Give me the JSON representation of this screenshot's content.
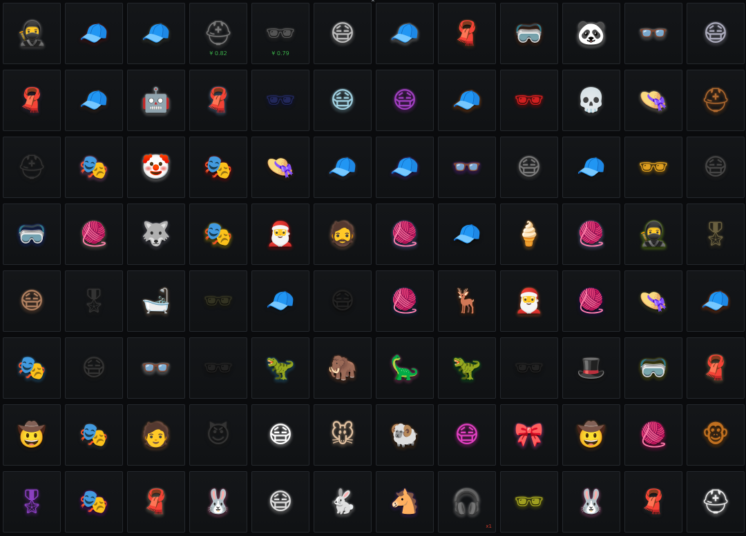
{
  "scroll_up_icon": "chevron-up-icon",
  "colors": {
    "price": "#3bb04a",
    "quantity": "#d03a2a",
    "tile_border": "#24282d"
  },
  "items": [
    {
      "icon": "balaclava-mask-icon",
      "glyph": "🥷",
      "color": "#9a9a9a"
    },
    {
      "icon": "cap-icon",
      "glyph": "🧢",
      "color": "#8a2a2a"
    },
    {
      "icon": "cap-icon",
      "glyph": "🧢",
      "color": "#6b6e5a"
    },
    {
      "icon": "pilot-helmet-icon",
      "glyph": "⛑",
      "color": "#7a7a7a",
      "price": "¥ 0.82"
    },
    {
      "icon": "sunglasses-icon",
      "glyph": "🕶",
      "color": "#555",
      "price": "¥ 0.79"
    },
    {
      "icon": "face-mask-icon",
      "glyph": "😷",
      "color": "#bbb"
    },
    {
      "icon": "cap-icon",
      "glyph": "🧢",
      "color": "#ddd"
    },
    {
      "icon": "scarf-icon",
      "glyph": "🧣",
      "color": "#8a5a30"
    },
    {
      "icon": "goggles-icon",
      "glyph": "🥽",
      "color": "#8a4a2a"
    },
    {
      "icon": "panda-headband-icon",
      "glyph": "🐼",
      "color": "#eee"
    },
    {
      "icon": "glasses-icon",
      "glyph": "👓",
      "color": "#ccc"
    },
    {
      "icon": "face-mask-icon",
      "glyph": "😷",
      "color": "#aab"
    },
    {
      "icon": "bandana-icon",
      "glyph": "🧣",
      "color": "#5a4a6a"
    },
    {
      "icon": "flat-cap-icon",
      "glyph": "🧢",
      "color": "#6a4a38"
    },
    {
      "icon": "robot-mask-icon",
      "glyph": "🤖",
      "color": "#ccc"
    },
    {
      "icon": "bandana-icon",
      "glyph": "🧣",
      "color": "#8ab0e0"
    },
    {
      "icon": "visor-icon",
      "glyph": "🕶",
      "color": "#22285a"
    },
    {
      "icon": "face-mask-icon",
      "glyph": "😷",
      "color": "#a0d0e0"
    },
    {
      "icon": "gas-mask-icon",
      "glyph": "😷",
      "color": "#a040c0"
    },
    {
      "icon": "cap-icon",
      "glyph": "🧢",
      "color": "#e07020"
    },
    {
      "icon": "sunglasses-icon",
      "glyph": "🕶",
      "color": "#d02020"
    },
    {
      "icon": "skull-mask-icon",
      "glyph": "💀",
      "color": "#888"
    },
    {
      "icon": "pith-helmet-icon",
      "glyph": "👒",
      "color": "#e0d0b0"
    },
    {
      "icon": "aviator-helmet-icon",
      "glyph": "⛑",
      "color": "#b06a30"
    },
    {
      "icon": "motorcycle-helmet-icon",
      "glyph": "⛑",
      "color": "#333"
    },
    {
      "icon": "cyber-mask-icon",
      "glyph": "🎭",
      "color": "#e080c0"
    },
    {
      "icon": "clown-mask-icon",
      "glyph": "🤡",
      "color": "#eee"
    },
    {
      "icon": "luchador-mask-icon",
      "glyph": "🎭",
      "color": "#c02020"
    },
    {
      "icon": "bucket-hat-icon",
      "glyph": "👒",
      "color": "#5a3a20"
    },
    {
      "icon": "beret-icon",
      "glyph": "🧢",
      "color": "#556"
    },
    {
      "icon": "cap-icon",
      "glyph": "🧢",
      "color": "#6a40c0"
    },
    {
      "icon": "round-glasses-icon",
      "glyph": "👓",
      "color": "#8a40d0"
    },
    {
      "icon": "face-mask-icon",
      "glyph": "😷",
      "color": "#777"
    },
    {
      "icon": "cap-icon",
      "glyph": "🧢",
      "color": "#333"
    },
    {
      "icon": "sunglasses-icon",
      "glyph": "🕶",
      "color": "#e0a020"
    },
    {
      "icon": "gas-mask-icon",
      "glyph": "😷",
      "color": "#444"
    },
    {
      "icon": "goggles-icon",
      "glyph": "🥽",
      "color": "#3050c0"
    },
    {
      "icon": "beanie-icon",
      "glyph": "🧶",
      "color": "#b0a090"
    },
    {
      "icon": "husky-mask-icon",
      "glyph": "🐺",
      "color": "#889"
    },
    {
      "icon": "yellow-mask-icon",
      "glyph": "🎭",
      "color": "#f0d020"
    },
    {
      "icon": "santa-hat-icon",
      "glyph": "🎅",
      "color": "#d02020"
    },
    {
      "icon": "bald-head-icon",
      "glyph": "🧔",
      "color": "#c09070"
    },
    {
      "icon": "beanie-icon",
      "glyph": "🧶",
      "color": "#8080d0"
    },
    {
      "icon": "police-cap-icon",
      "glyph": "🧢",
      "color": "#222"
    },
    {
      "icon": "ice-cream-hat-icon",
      "glyph": "🍦",
      "color": "#f0a040"
    },
    {
      "icon": "beanie-icon",
      "glyph": "🧶",
      "color": "#9090d0"
    },
    {
      "icon": "balaclava-icon",
      "glyph": "🥷",
      "color": "#b0f030"
    },
    {
      "icon": "officer-cap-icon",
      "glyph": "🎖",
      "color": "#6a6040"
    },
    {
      "icon": "respirator-icon",
      "glyph": "😷",
      "color": "#b08060"
    },
    {
      "icon": "officer-cap-icon",
      "glyph": "🎖",
      "color": "#333"
    },
    {
      "icon": "shower-cap-icon",
      "glyph": "🛁",
      "color": "#c0a080"
    },
    {
      "icon": "sunglasses-icon",
      "glyph": "🕶",
      "color": "#332"
    },
    {
      "icon": "cap-icon",
      "glyph": "🧢",
      "color": "#234"
    },
    {
      "icon": "face-mask-icon",
      "glyph": "😷",
      "color": "#222"
    },
    {
      "icon": "beanie-icon",
      "glyph": "🧶",
      "color": "#2a4a80"
    },
    {
      "icon": "reindeer-mask-icon",
      "glyph": "🦌",
      "color": "#8a4a20"
    },
    {
      "icon": "santa-hat-icon",
      "glyph": "🎅",
      "color": "#f07040"
    },
    {
      "icon": "beanie-icon",
      "glyph": "🧶",
      "color": "#3a2080"
    },
    {
      "icon": "pith-helmet-icon",
      "glyph": "👒",
      "color": "#7a8040"
    },
    {
      "icon": "cap-icon",
      "glyph": "🧢",
      "color": "#e06020"
    },
    {
      "icon": "cyber-mask-icon",
      "glyph": "🎭",
      "color": "#40a0e0"
    },
    {
      "icon": "face-mask-icon",
      "glyph": "😷",
      "color": "#333"
    },
    {
      "icon": "glasses-icon",
      "glyph": "👓",
      "color": "#eee"
    },
    {
      "icon": "sunglasses-icon",
      "glyph": "🕶",
      "color": "#222"
    },
    {
      "icon": "dinosaur-mask-icon",
      "glyph": "🦖",
      "color": "#40a0d0"
    },
    {
      "icon": "mammoth-mask-icon",
      "glyph": "🦣",
      "color": "#a06040"
    },
    {
      "icon": "dinosaur-mask-icon",
      "glyph": "🦕",
      "color": "#e060a0"
    },
    {
      "icon": "dinosaur-mask-icon",
      "glyph": "🦖",
      "color": "#20a040"
    },
    {
      "icon": "sunglasses-icon",
      "glyph": "🕶",
      "color": "#222"
    },
    {
      "icon": "fedora-icon",
      "glyph": "🎩",
      "color": "#333"
    },
    {
      "icon": "goggles-icon",
      "glyph": "🥽",
      "color": "#a0a020"
    },
    {
      "icon": "scarf-icon",
      "glyph": "🧣",
      "color": "#c0a070"
    },
    {
      "icon": "cowboy-hat-icon",
      "glyph": "🤠",
      "color": "#4a3a2a"
    },
    {
      "icon": "tactical-mask-icon",
      "glyph": "🎭",
      "color": "#666"
    },
    {
      "icon": "face-paint-head-icon",
      "glyph": "🧑",
      "color": "#c08050"
    },
    {
      "icon": "horned-mask-icon",
      "glyph": "😈",
      "color": "#333"
    },
    {
      "icon": "face-mask-icon",
      "glyph": "😷",
      "color": "#fff"
    },
    {
      "icon": "mouse-mask-icon",
      "glyph": "🐭",
      "color": "#e0c0a0"
    },
    {
      "icon": "ram-mask-icon",
      "glyph": "🐏",
      "color": "#8a5a30"
    },
    {
      "icon": "gas-mask-icon",
      "glyph": "😷",
      "color": "#e040c0"
    },
    {
      "icon": "bow-headband-icon",
      "glyph": "🎀",
      "color": "#f060c0"
    },
    {
      "icon": "cowboy-hat-icon",
      "glyph": "🤠",
      "color": "#8a5a30"
    },
    {
      "icon": "beanie-icon",
      "glyph": "🧶",
      "color": "#e02080"
    },
    {
      "icon": "monkey-mask-icon",
      "glyph": "🐵",
      "color": "#c07020"
    },
    {
      "icon": "officer-cap-icon",
      "glyph": "🎖",
      "color": "#8a40c0"
    },
    {
      "icon": "cyber-mask-icon",
      "glyph": "🎭",
      "color": "#a020c0"
    },
    {
      "icon": "bandana-icon",
      "glyph": "🧣",
      "color": "#d0c0a0"
    },
    {
      "icon": "bunny-hat-icon",
      "glyph": "🐰",
      "color": "#f080b0"
    },
    {
      "icon": "face-mask-icon",
      "glyph": "😷",
      "color": "#ddd"
    },
    {
      "icon": "rabbit-mask-icon",
      "glyph": "🐇",
      "color": "#ddd"
    },
    {
      "icon": "horse-mask-icon",
      "glyph": "🐴",
      "color": "#6a40a0"
    },
    {
      "icon": "headset-icon",
      "glyph": "🎧",
      "color": "#ccc",
      "qty": "x1"
    },
    {
      "icon": "sunglasses-icon",
      "glyph": "🕶",
      "color": "#a0a020"
    },
    {
      "icon": "bunny-ears-icon",
      "glyph": "🐰",
      "color": "#f080c0"
    },
    {
      "icon": "bandana-icon",
      "glyph": "🧣",
      "color": "#555"
    },
    {
      "icon": "helmet-icon",
      "glyph": "⛑",
      "color": "#eee"
    }
  ]
}
